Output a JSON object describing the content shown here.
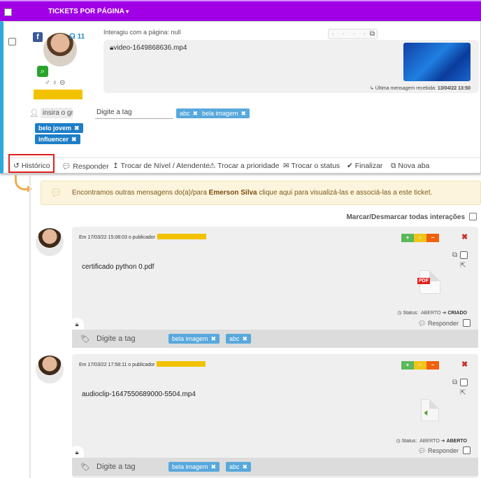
{
  "topbar": {
    "tickets_per_page": "TICKETS POR PÁGINA"
  },
  "ticket": {
    "fb_letter": "f",
    "headset_count": "11",
    "interacted": "Interagiu com a página: null",
    "file": "video-1649868636.mp4",
    "last_msg_label": "Última mensagem recebida:",
    "last_msg_date": "13/04/22 13:50",
    "name_placeholder": "insira o gr",
    "contact_tags": [
      "belo jovem",
      "influencer"
    ],
    "tag_input_placeholder": "Digite a tag",
    "ticket_tags": [
      "abc",
      "bela imagem"
    ]
  },
  "actions": {
    "historico": "Histórico",
    "responder": "Responder",
    "trocar_nivel": "Trocar de Nível / Atendente",
    "trocar_prioridade": "Trocar a prioridade",
    "trocar_status": "Trocar o status",
    "finalizar": "Finalizar",
    "nova_aba": "Nova aba"
  },
  "notice": {
    "before": "Encontramos outras mensagens do(a)/para ",
    "name": "Emerson Silva",
    "after": " clique aqui para visualizá-las e associá-las a este ticket."
  },
  "mark_all": "Marcar/Desmarcar todas interações",
  "interactions": [
    {
      "meta": "Em 17/03/22 15:08:03 o publicador",
      "filename": "certificado python 0.pdf",
      "file_type_label": "PDF",
      "status_label": "Status:",
      "status_from": "ABERTO",
      "status_to": "CRIADO",
      "reply": "Responder",
      "tag_placeholder": "Digite a tag",
      "tags": [
        "bela imagem",
        "abc"
      ]
    },
    {
      "meta": "Em 17/03/22 17:58:11 o publicador",
      "filename": "audioclip-1647550689000-5504.mp4",
      "status_label": "Status:",
      "status_from": "ABERTO",
      "status_to": "ABERTO",
      "reply": "Responder",
      "tag_placeholder": "Digite a tag",
      "tags": [
        "bela imagem",
        "abc"
      ]
    }
  ],
  "colors": {
    "topbar": "#a100e6",
    "accent": "#2fa8dc",
    "tag": "#1d7ec7",
    "highlight": "#f2c200"
  }
}
